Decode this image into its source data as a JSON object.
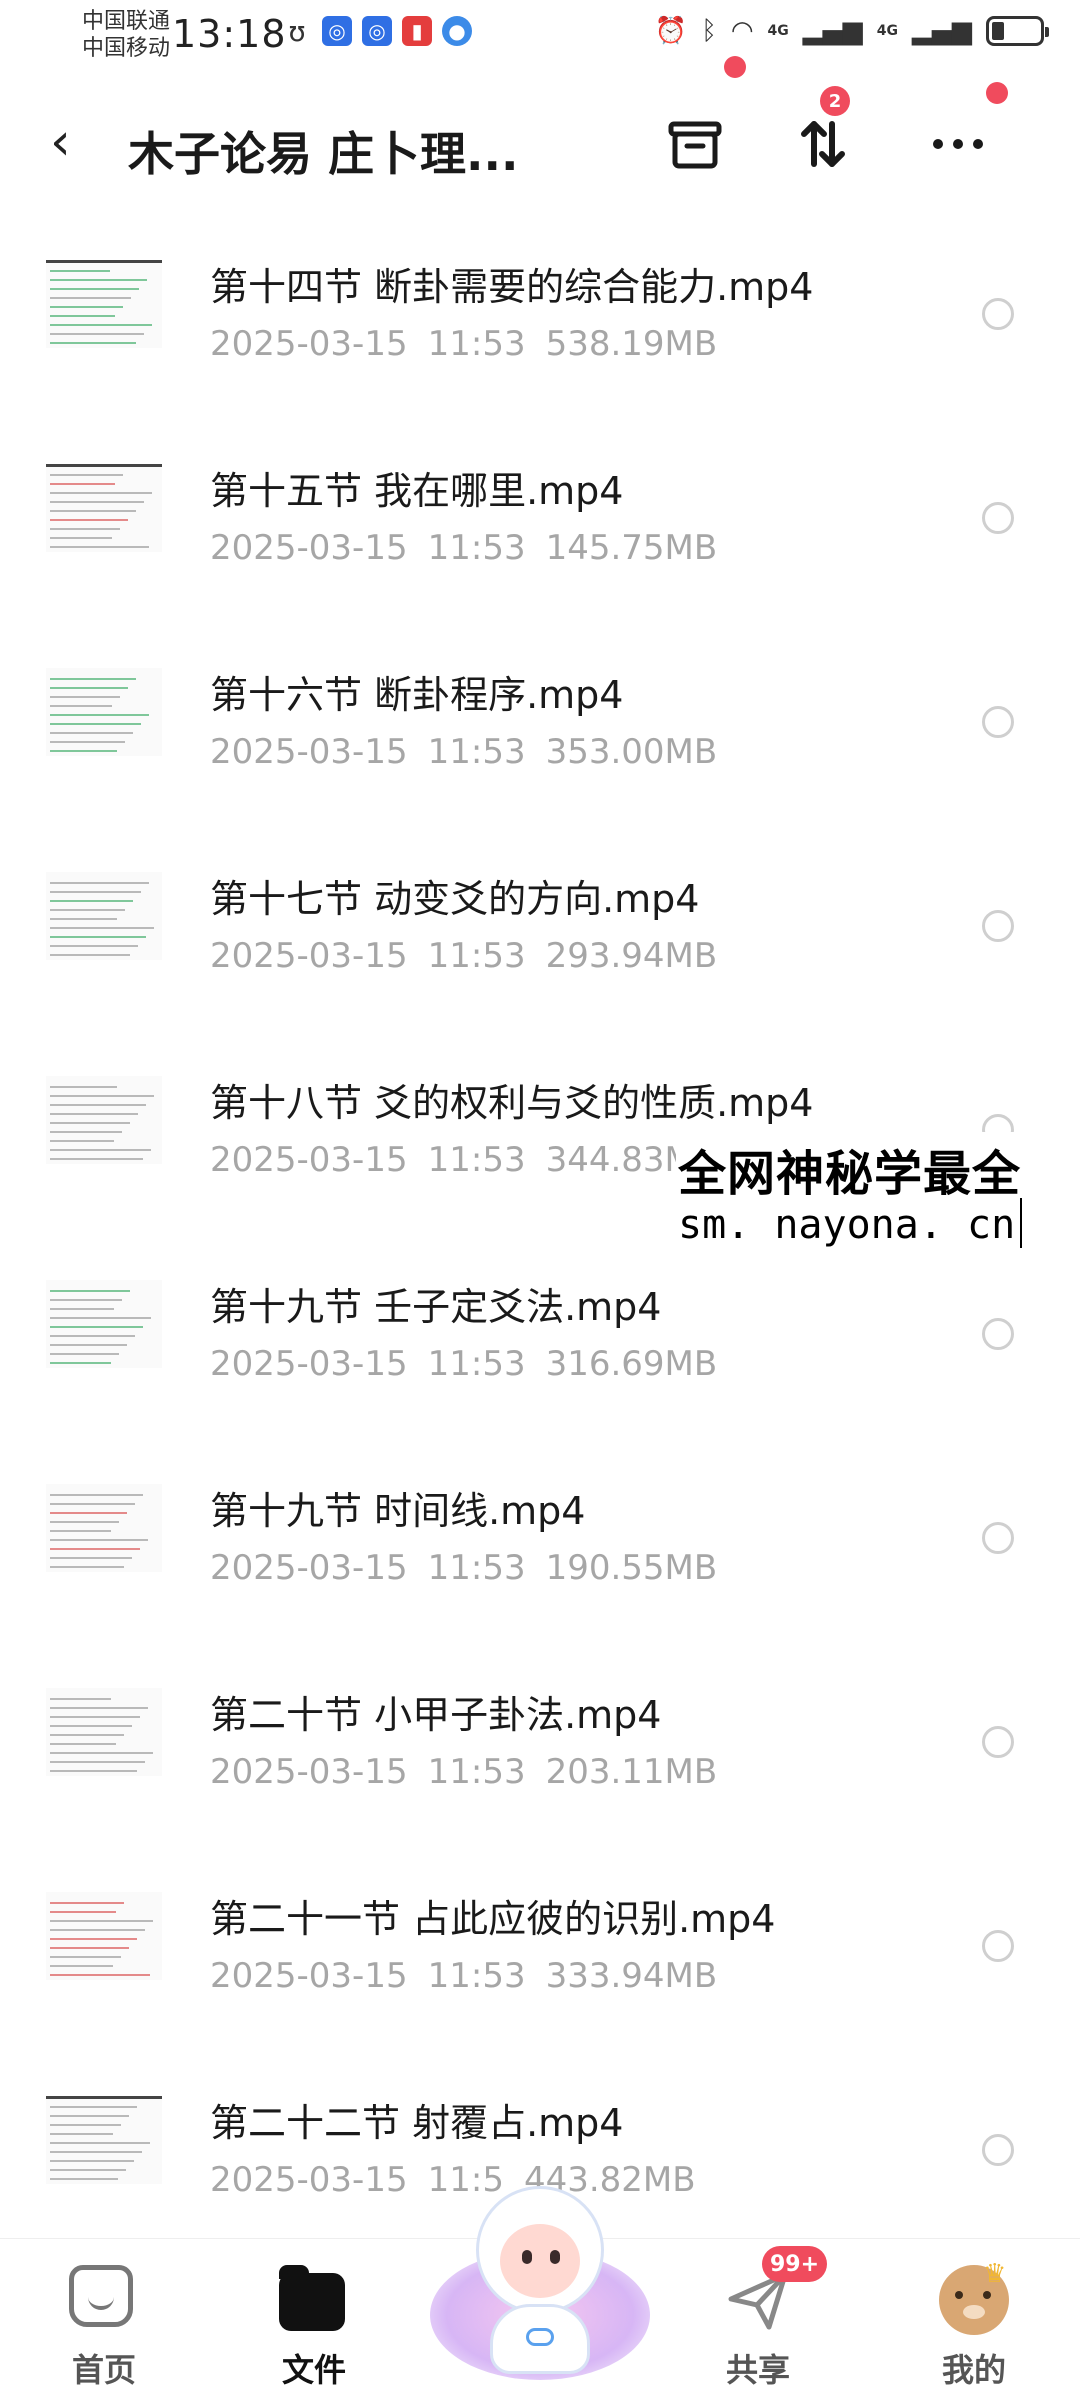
{
  "status_bar": {
    "carrier_1": "中国联通",
    "carrier_2": "中国移动",
    "time": "13:18",
    "network_1": "4G",
    "network_2": "4G",
    "battery_level": 0.26
  },
  "header": {
    "back_icon": "chevron-left-icon",
    "title": "木子论易 庄卜理...",
    "sort_badge_count": "2"
  },
  "files": [
    {
      "name": "第十四节  断卦需要的综合能力.mp4",
      "date": "2025-03-15",
      "time": "11:53",
      "size": "538.19MB"
    },
    {
      "name": "第十五节 我在哪里.mp4",
      "date": "2025-03-15",
      "time": "11:53",
      "size": "145.75MB"
    },
    {
      "name": "第十六节 断卦程序.mp4",
      "date": "2025-03-15",
      "time": "11:53",
      "size": "353.00MB"
    },
    {
      "name": "第十七节 动变爻的方向.mp4",
      "date": "2025-03-15",
      "time": "11:53",
      "size": "293.94MB"
    },
    {
      "name": "第十八节 爻的权利与爻的性质.mp4",
      "date": "2025-03-15",
      "time": "11:53",
      "size": "344.83M"
    },
    {
      "name": "第十九节 壬子定爻法.mp4",
      "date": "2025-03-15",
      "time": "11:53",
      "size": "316.69MB"
    },
    {
      "name": "第十九节 时间线.mp4",
      "date": "2025-03-15",
      "time": "11:53",
      "size": "190.55MB"
    },
    {
      "name": "第二十节 小甲子卦法.mp4",
      "date": "2025-03-15",
      "time": "11:53",
      "size": "203.11MB"
    },
    {
      "name": "第二十一节 占此应彼的识别.mp4",
      "date": "2025-03-15",
      "time": "11:53",
      "size": "333.94MB"
    },
    {
      "name": "第二十二节 射覆占.mp4",
      "date": "2025-03-15",
      "time": "11:5",
      "size": "443.82MB"
    }
  ],
  "watermark": {
    "line1": "全网神秘学最全",
    "line2": "sm. nayona. cn"
  },
  "bottom_nav": {
    "home": "首页",
    "files": "文件",
    "share": "共享",
    "mine": "我的",
    "share_badge": "99+"
  },
  "colors": {
    "accent_red": "#f04b5d",
    "meta_gray": "#a6a6a6"
  }
}
